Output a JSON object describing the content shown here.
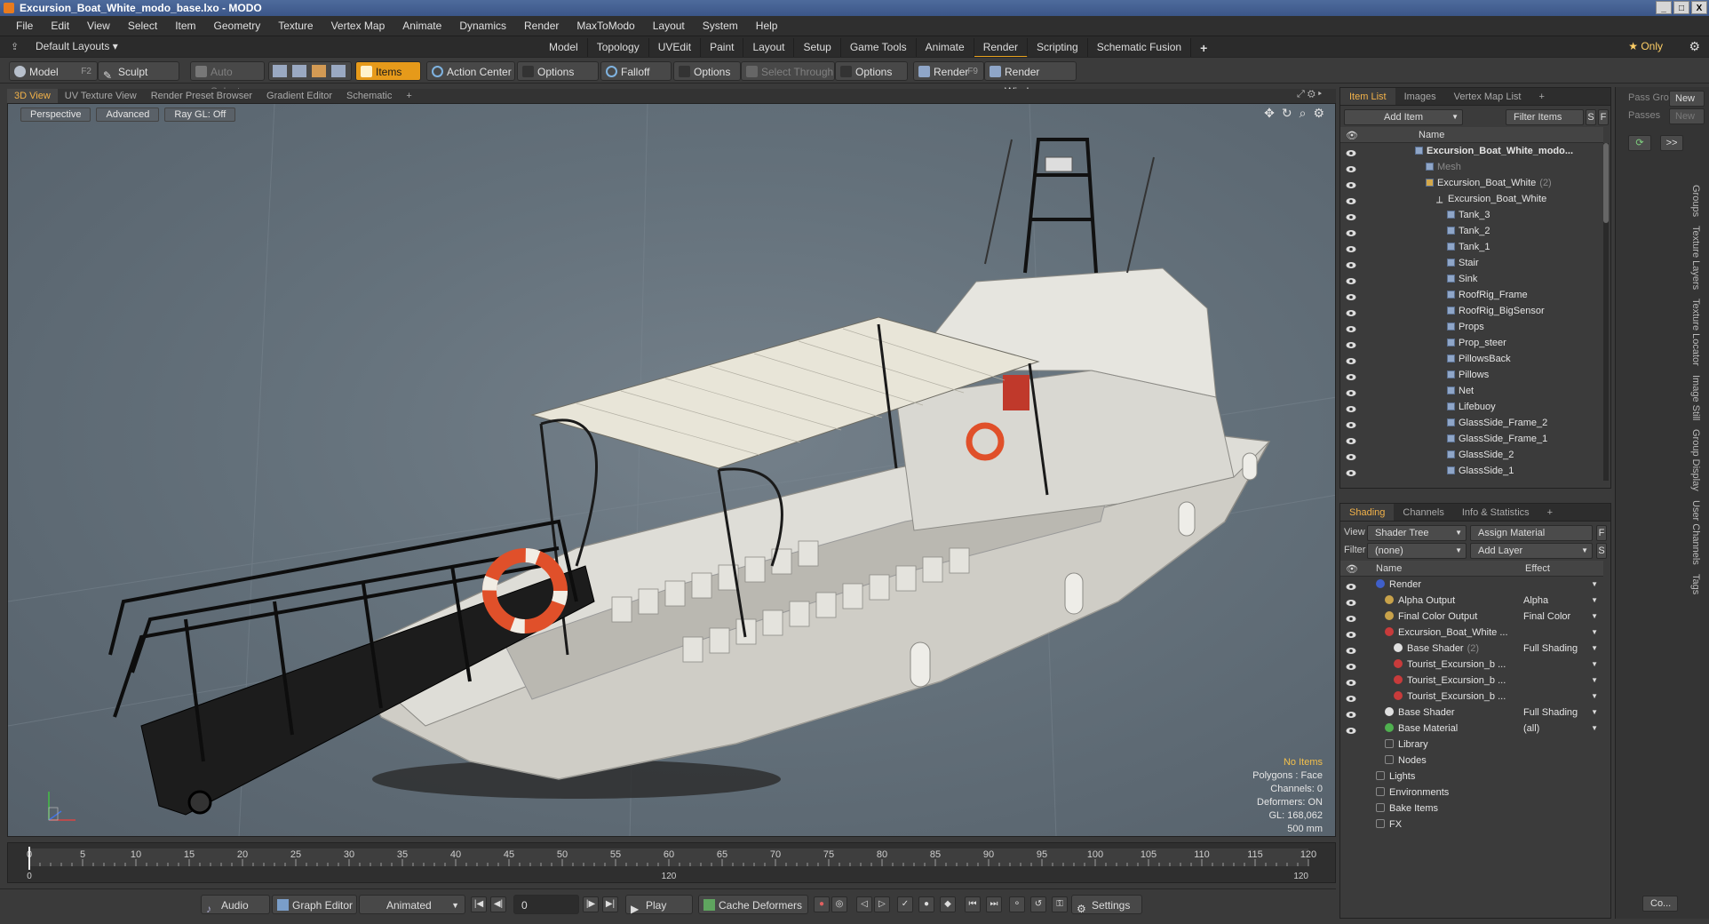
{
  "window": {
    "title": "Excursion_Boat_White_modo_base.lxo - MODO",
    "buttons": [
      "_",
      "□",
      "X"
    ]
  },
  "menu": [
    "File",
    "Edit",
    "View",
    "Select",
    "Item",
    "Geometry",
    "Texture",
    "Vertex Map",
    "Animate",
    "Dynamics",
    "Render",
    "MaxToModo",
    "Layout",
    "System",
    "Help"
  ],
  "layoutbar": {
    "layout": "Default Layouts ▾",
    "tabs": [
      "Model",
      "Topology",
      "UVEdit",
      "Paint",
      "Layout",
      "Setup",
      "Game Tools",
      "Animate",
      "Render",
      "Scripting",
      "Schematic Fusion",
      "+"
    ],
    "active_tab": "Render",
    "only": "★ Only"
  },
  "toolbar": {
    "model": "Model",
    "model_key": "F2",
    "sculpt": "Sculpt",
    "auto_select": "Auto Select",
    "items": "Items",
    "action_center": "Action Center",
    "options1": "Options",
    "falloff": "Falloff",
    "options2": "Options",
    "select_through": "Select Through",
    "options3": "Options",
    "render": "Render",
    "render_key": "F9",
    "render_window": "Render Window"
  },
  "viewport_tabs": [
    "3D View",
    "UV Texture View",
    "Render Preset Browser",
    "Gradient Editor",
    "Schematic",
    "+"
  ],
  "viewport": {
    "options": [
      "Perspective",
      "Advanced",
      "Ray GL: Off"
    ],
    "info": {
      "selection": "No Items",
      "polygons": "Polygons : Face",
      "channels": "Channels: 0",
      "deformers": "Deformers: ON",
      "gl": "GL: 168,062",
      "scale": "500 mm"
    }
  },
  "timeline": {
    "ticks": [
      0,
      5,
      10,
      15,
      20,
      25,
      30,
      35,
      40,
      45,
      50,
      55,
      60,
      65,
      70,
      75,
      80,
      85,
      90,
      95,
      100,
      105,
      110,
      115,
      120
    ],
    "start": "0",
    "mid": "120",
    "end": "120"
  },
  "transport": {
    "audio": "Audio",
    "graph_editor": "Graph Editor",
    "animated": "Animated",
    "frame": "0",
    "play": "Play",
    "cache_deformers": "Cache Deformers",
    "settings": "Settings"
  },
  "item_list": {
    "tabs": [
      "Item List",
      "Images",
      "Vertex Map List",
      "+"
    ],
    "add_item": "Add Item",
    "filter_items": "Filter Items",
    "s_btn": "S",
    "f_btn": "F",
    "column_name": "Name",
    "rows": [
      {
        "label": "Excursion_Boat_White_modo...",
        "indent": 0,
        "kind": "scene",
        "bold": true
      },
      {
        "label": "Mesh",
        "indent": 1,
        "kind": "mesh-dim"
      },
      {
        "label": "Excursion_Boat_White",
        "extra": "(2)",
        "indent": 1,
        "kind": "group"
      },
      {
        "label": "Excursion_Boat_White",
        "indent": 2,
        "kind": "locator"
      },
      {
        "label": "Tank_3",
        "indent": 3,
        "kind": "mesh"
      },
      {
        "label": "Tank_2",
        "indent": 3,
        "kind": "mesh"
      },
      {
        "label": "Tank_1",
        "indent": 3,
        "kind": "mesh"
      },
      {
        "label": "Stair",
        "indent": 3,
        "kind": "mesh"
      },
      {
        "label": "Sink",
        "indent": 3,
        "kind": "mesh"
      },
      {
        "label": "RoofRig_Frame",
        "indent": 3,
        "kind": "mesh"
      },
      {
        "label": "RoofRig_BigSensor",
        "indent": 3,
        "kind": "mesh"
      },
      {
        "label": "Props",
        "indent": 3,
        "kind": "mesh"
      },
      {
        "label": "Prop_steer",
        "indent": 3,
        "kind": "mesh"
      },
      {
        "label": "PillowsBack",
        "indent": 3,
        "kind": "mesh"
      },
      {
        "label": "Pillows",
        "indent": 3,
        "kind": "mesh"
      },
      {
        "label": "Net",
        "indent": 3,
        "kind": "mesh"
      },
      {
        "label": "Lifebuoy",
        "indent": 3,
        "kind": "mesh"
      },
      {
        "label": "GlassSide_Frame_2",
        "indent": 3,
        "kind": "mesh"
      },
      {
        "label": "GlassSide_Frame_1",
        "indent": 3,
        "kind": "mesh"
      },
      {
        "label": "GlassSide_2",
        "indent": 3,
        "kind": "mesh"
      },
      {
        "label": "GlassSide_1",
        "indent": 3,
        "kind": "mesh"
      }
    ]
  },
  "shading": {
    "tabs": [
      "Shading",
      "Channels",
      "Info & Statistics",
      "+"
    ],
    "view_label": "View",
    "view_value": "Shader Tree",
    "assign_material": "Assign Material",
    "f_btn": "F",
    "filter_label": "Filter",
    "filter_value": "(none)",
    "add_layer": "Add Layer",
    "s_btn": "S",
    "col_name": "Name",
    "col_effect": "Effect",
    "rows": [
      {
        "label": "Render",
        "effect": "",
        "indent": 0,
        "dot": "#3f5fc9"
      },
      {
        "label": "Alpha Output",
        "effect": "Alpha",
        "indent": 1,
        "dot": "#c8a24a"
      },
      {
        "label": "Final Color Output",
        "effect": "Final Color",
        "indent": 1,
        "dot": "#c8a24a"
      },
      {
        "label": "Excursion_Boat_White ...",
        "effect": "",
        "indent": 1,
        "dot": "#c83b3b"
      },
      {
        "label": "Base Shader",
        "extra": "(2)",
        "effect": "Full Shading",
        "indent": 2,
        "dot": "#e0e0e0"
      },
      {
        "label": "Tourist_Excursion_b ...",
        "effect": "",
        "indent": 2,
        "dot": "#c83b3b"
      },
      {
        "label": "Tourist_Excursion_b ...",
        "effect": "",
        "indent": 2,
        "dot": "#c83b3b"
      },
      {
        "label": "Tourist_Excursion_b ...",
        "effect": "",
        "indent": 2,
        "dot": "#c83b3b"
      },
      {
        "label": "Base Shader",
        "effect": "Full Shading",
        "indent": 1,
        "dot": "#e0e0e0"
      },
      {
        "label": "Base Material",
        "effect": "(all)",
        "indent": 1,
        "dot": "#4fb04f"
      },
      {
        "label": "Library",
        "effect": "",
        "indent": 1,
        "dot": ""
      },
      {
        "label": "Nodes",
        "effect": "",
        "indent": 1,
        "dot": ""
      },
      {
        "label": "Lights",
        "effect": "",
        "indent": 0,
        "dot": ""
      },
      {
        "label": "Environments",
        "effect": "",
        "indent": 0,
        "dot": ""
      },
      {
        "label": "Bake Items",
        "effect": "",
        "indent": 0,
        "dot": ""
      },
      {
        "label": "FX",
        "effect": "",
        "indent": 0,
        "dot": ""
      }
    ]
  },
  "pass": {
    "pass_group": "Pass Gro",
    "passes": "Passes",
    "new1": "New",
    "new2": "New",
    "expand": ">>",
    "co": "Co..."
  },
  "side_tabs": [
    "Groups",
    "Texture Layers",
    "Texture Locator",
    "Image Still",
    "Group Display",
    "User Channels",
    "Tags"
  ]
}
